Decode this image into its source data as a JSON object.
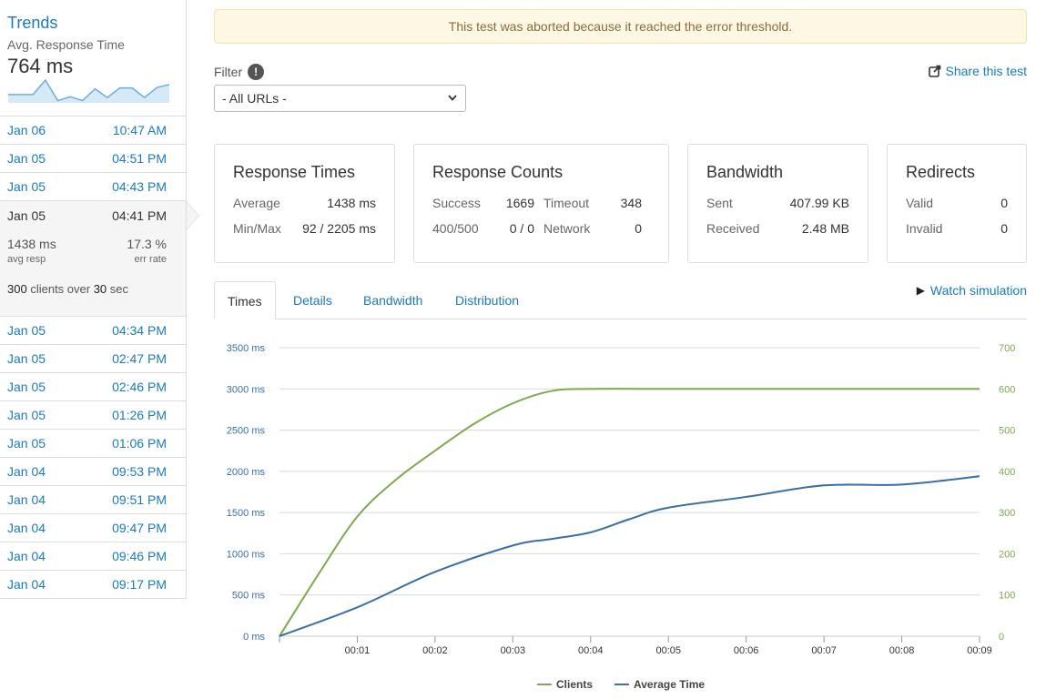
{
  "sidebar": {
    "trends_title": "Trends",
    "trends_subtitle": "Avg. Response Time",
    "trends_value": "764 ms",
    "sparkline_values": [
      17,
      17,
      17,
      50,
      3,
      12,
      3,
      30,
      10,
      32,
      32,
      10,
      33,
      40
    ],
    "runs_before": [
      {
        "date": "Jan 06",
        "time": "10:47 AM"
      },
      {
        "date": "Jan 05",
        "time": "04:51 PM"
      },
      {
        "date": "Jan 05",
        "time": "04:43 PM"
      }
    ],
    "active_run": {
      "date": "Jan 05",
      "time": "04:41 PM",
      "avg_resp_value": "1438 ms",
      "avg_resp_label": "avg resp",
      "err_rate_value": "17.3 %",
      "err_rate_label": "err rate",
      "clients": "300",
      "clients_text": "clients over",
      "duration": "30",
      "duration_unit": "sec"
    },
    "runs_after": [
      {
        "date": "Jan 05",
        "time": "04:34 PM"
      },
      {
        "date": "Jan 05",
        "time": "02:47 PM"
      },
      {
        "date": "Jan 05",
        "time": "02:46 PM"
      },
      {
        "date": "Jan 05",
        "time": "01:26 PM"
      },
      {
        "date": "Jan 05",
        "time": "01:06 PM"
      },
      {
        "date": "Jan 04",
        "time": "09:53 PM"
      },
      {
        "date": "Jan 04",
        "time": "09:51 PM"
      },
      {
        "date": "Jan 04",
        "time": "09:47 PM"
      },
      {
        "date": "Jan 04",
        "time": "09:46 PM"
      },
      {
        "date": "Jan 04",
        "time": "09:17 PM"
      }
    ]
  },
  "alert": "This test was aborted because it reached the error threshold.",
  "filter": {
    "label": "Filter",
    "info_icon": "!",
    "selected": "- All URLs -"
  },
  "share_label": "Share this test",
  "cards": {
    "response_times": {
      "title": "Response Times",
      "average_label": "Average",
      "average_value": "1438 ms",
      "minmax_label": "Min/Max",
      "minmax_value": "92 / 2205 ms"
    },
    "response_counts": {
      "title": "Response Counts",
      "success_label": "Success",
      "success_value": "1669",
      "timeout_label": "Timeout",
      "timeout_value": "348",
      "errors_label": "400/500",
      "errors_value": "0 / 0",
      "network_label": "Network",
      "network_value": "0"
    },
    "bandwidth": {
      "title": "Bandwidth",
      "sent_label": "Sent",
      "sent_value": "407.99 KB",
      "received_label": "Received",
      "received_value": "2.48 MB"
    },
    "redirects": {
      "title": "Redirects",
      "valid_label": "Valid",
      "valid_value": "0",
      "invalid_label": "Invalid",
      "invalid_value": "0"
    }
  },
  "tabs": [
    "Times",
    "Details",
    "Bandwidth",
    "Distribution"
  ],
  "watch_label": "Watch simulation",
  "colors": {
    "link": "#1a7bb9",
    "clients": "#7ea84e",
    "avg_time": "#3a6ea5"
  },
  "chart_data": {
    "type": "line",
    "x": [
      0,
      1,
      2,
      3,
      4,
      5,
      6,
      7,
      8,
      9
    ],
    "x_tick_labels": [
      "00:01",
      "00:02",
      "00:03",
      "00:04",
      "00:05",
      "00:06",
      "00:07",
      "00:08",
      "00:09"
    ],
    "y_left_ticks": [
      "0 ms",
      "500 ms",
      "1000 ms",
      "1500 ms",
      "2000 ms",
      "2500 ms",
      "3000 ms",
      "3500 ms"
    ],
    "y_left_range": [
      0,
      3500
    ],
    "y_right_ticks": [
      "0",
      "100",
      "200",
      "300",
      "400",
      "500",
      "600",
      "700"
    ],
    "y_right_range": [
      0,
      700
    ],
    "grid": true,
    "legend_position": "bottom",
    "series": [
      {
        "name": "Clients",
        "axis": "right",
        "x": [
          0,
          0.5,
          1,
          1.5,
          2,
          2.5,
          3,
          3.5,
          4,
          5,
          6,
          7,
          8,
          9
        ],
        "values": [
          0,
          150,
          290,
          380,
          450,
          515,
          565,
          595,
          600,
          600,
          600,
          600,
          600,
          600
        ]
      },
      {
        "name": "Average Time",
        "axis": "left",
        "x": [
          0,
          1,
          2,
          3,
          3.5,
          4,
          4.5,
          5,
          6,
          7,
          8,
          9
        ],
        "values": [
          0,
          350,
          780,
          1100,
          1180,
          1260,
          1420,
          1560,
          1690,
          1830,
          1840,
          1940
        ]
      }
    ]
  }
}
